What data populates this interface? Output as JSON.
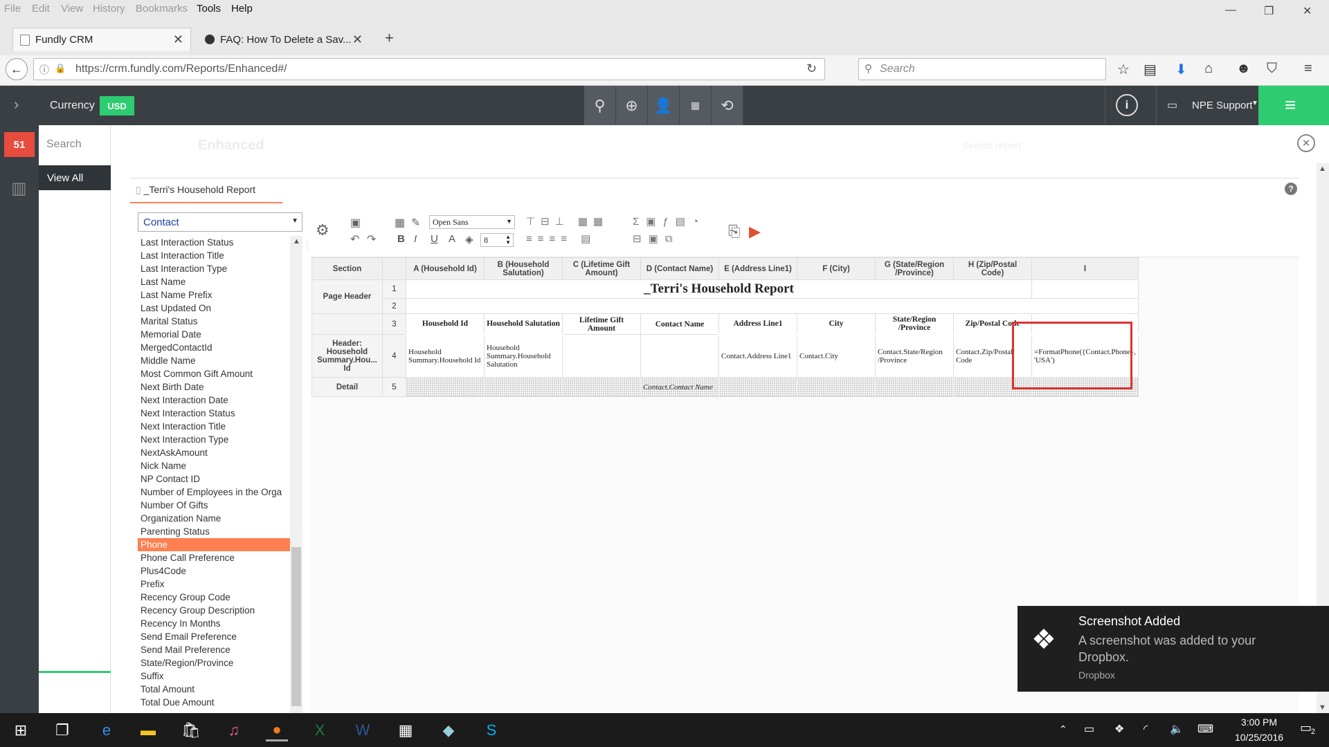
{
  "browser": {
    "menu": [
      "File",
      "Edit",
      "View",
      "History",
      "Bookmarks",
      "Tools",
      "Help"
    ],
    "tabs": [
      {
        "title": "Fundly CRM"
      },
      {
        "title": "FAQ: How To Delete a Sav..."
      }
    ],
    "url": "https://crm.fundly.com/Reports/Enhanced#/",
    "search_placeholder": "Search"
  },
  "app": {
    "currency_label": "Currency",
    "currency_value": "USD",
    "user": "NPE Support",
    "badge_count": "51",
    "search_label": "Search",
    "view_all": "View All",
    "enhanced_label": "Enhanced",
    "search_report_placeholder": "Search report"
  },
  "report": {
    "tab_title": "_Terri's Household Report",
    "category": "Contact",
    "font_name": "Open Sans",
    "font_size": "8",
    "fields": [
      "Last Interaction Status",
      "Last Interaction Title",
      "Last Interaction Type",
      "Last Name",
      "Last Name Prefix",
      "Last Updated On",
      "Marital Status",
      "Memorial Date",
      "MergedContactId",
      "Middle Name",
      "Most Common Gift Amount",
      "Next Birth Date",
      "Next Interaction Date",
      "Next Interaction Status",
      "Next Interaction Title",
      "Next Interaction Type",
      "NextAskAmount",
      "Nick Name",
      "NP Contact ID",
      "Number of Employees in the Orga",
      "Number Of Gifts",
      "Organization Name",
      "Parenting Status",
      "Phone",
      "Phone Call Preference",
      "Plus4Code",
      "Prefix",
      "Recency Group Code",
      "Recency Group Description",
      "Recency In Months",
      "Send Email Preference",
      "Send Mail Preference",
      "State/Region/Province",
      "Suffix",
      "Total Amount",
      "Total Due Amount"
    ],
    "selected_field": "Phone",
    "columns": [
      "Section",
      "",
      "A (Household Id)",
      "B (Household Salutation)",
      "C (Lifetime Gift Amount)",
      "D (Contact Name)",
      "E (Address Line1)",
      "F (City)",
      "G (State/Region /Province)",
      "H (Zip/Postal Code)",
      "I"
    ],
    "sections": {
      "page_header": "Page Header",
      "header": "Header: Household Summary.Hou... Id",
      "detail": "Detail"
    },
    "rows": [
      "1",
      "2",
      "3",
      "4",
      "5"
    ],
    "title_cell": "_Terri's Household Report",
    "row3": [
      "Household Id",
      "Household Salutation",
      "Lifetime Gift Amount",
      "Contact Name",
      "Address Line1",
      "City",
      "State/Region /Province",
      "Zip/Postal Code",
      ""
    ],
    "row4": [
      "Household Summary.Household Id",
      "Household Summary.Household Salutation",
      "",
      "",
      "Contact.Address Line1",
      "Contact.City",
      "Contact.State/Region /Province",
      "Contact.Zip/Postal Code",
      "=FormatPhone({Contact.Phone}, 'USA')"
    ],
    "row5_d": "Contact.Contact Name"
  },
  "toast": {
    "title": "Screenshot Added",
    "body": "A screenshot was added to your Dropbox.",
    "source": "Dropbox"
  },
  "taskbar": {
    "time": "3:00 PM",
    "date": "10/25/2016",
    "notif": "2"
  },
  "colors": {
    "header_bg": "#3a3f44",
    "accent_green": "#2ecc71",
    "badge_red": "#e74c3c",
    "selection": "#ff7f50",
    "highlight_box": "#e03030"
  }
}
